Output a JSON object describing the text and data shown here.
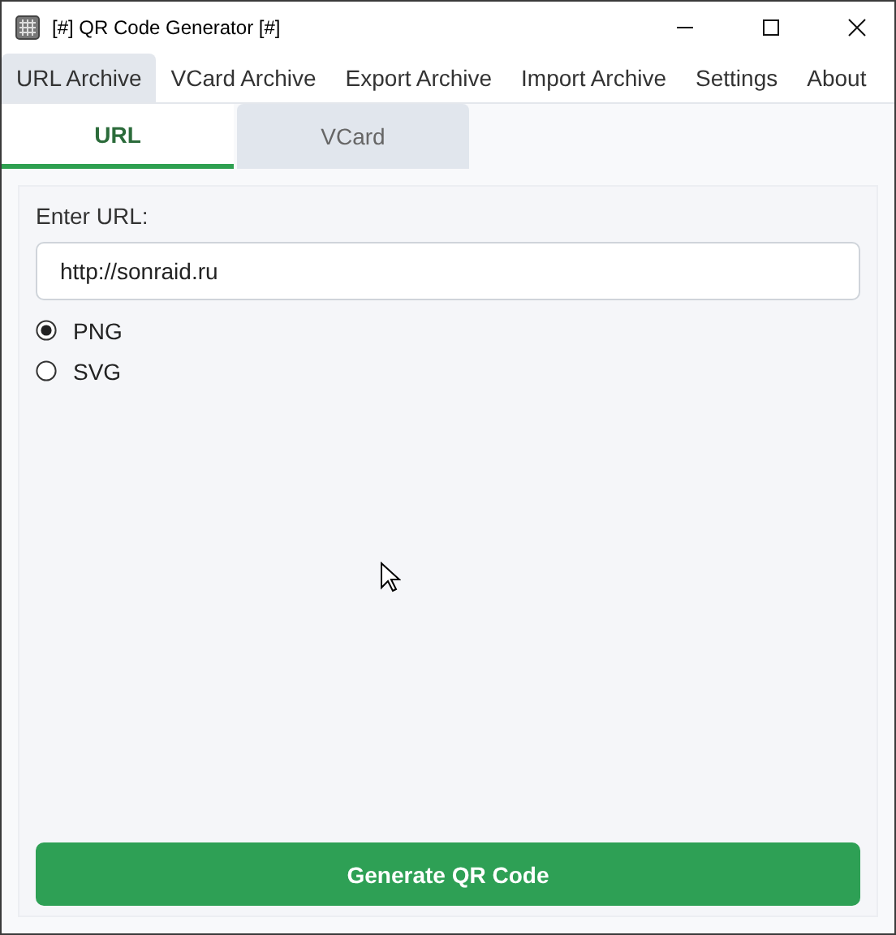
{
  "window": {
    "title": "[#] QR Code Generator [#]"
  },
  "menu": [
    {
      "label": "URL Archive",
      "selected": true
    },
    {
      "label": "VCard Archive",
      "selected": false
    },
    {
      "label": "Export Archive",
      "selected": false
    },
    {
      "label": "Import Archive",
      "selected": false
    },
    {
      "label": "Settings",
      "selected": false
    },
    {
      "label": "About",
      "selected": false
    }
  ],
  "tabs": [
    {
      "label": "URL",
      "selected": true
    },
    {
      "label": "VCard",
      "selected": false
    }
  ],
  "url_field": {
    "label": "Enter URL:",
    "value": "http://sonraid.ru"
  },
  "formats": [
    {
      "label": "PNG",
      "selected": true
    },
    {
      "label": "SVG",
      "selected": false
    }
  ],
  "generate_button": "Generate QR Code"
}
